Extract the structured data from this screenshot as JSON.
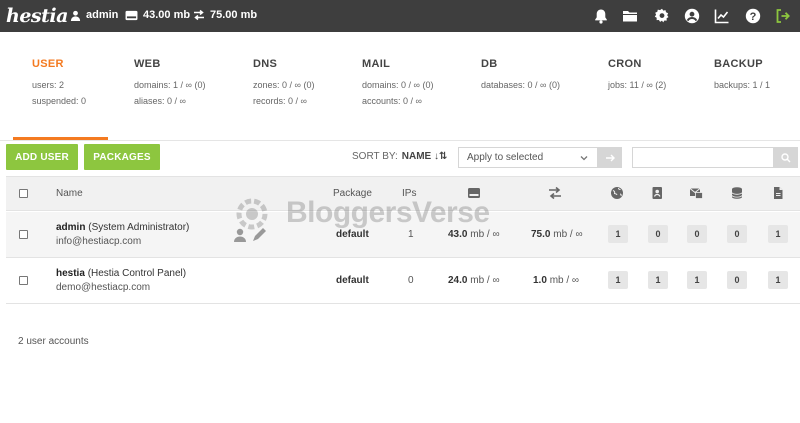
{
  "app": {
    "logo_text": "hestia"
  },
  "topbar": {
    "user": "admin",
    "disk": "43.00 mb",
    "bandwidth": "75.00 mb",
    "icons": [
      "bell-icon",
      "folder-icon",
      "gear-icon",
      "user-circle-icon",
      "chart-line-icon",
      "help-icon",
      "logout-icon"
    ]
  },
  "summary": [
    {
      "title": "USER",
      "lines": [
        "users: 2",
        "suspended: 0"
      ],
      "active": true
    },
    {
      "title": "WEB",
      "lines": [
        "domains: 1 / ∞ (0)",
        "aliases: 0 / ∞"
      ]
    },
    {
      "title": "DNS",
      "lines": [
        "zones: 0 / ∞ (0)",
        "records: 0 / ∞"
      ]
    },
    {
      "title": "MAIL",
      "lines": [
        "domains: 0 / ∞ (0)",
        "accounts: 0 / ∞"
      ]
    },
    {
      "title": "DB",
      "lines": [
        "databases: 0 / ∞ (0)"
      ]
    },
    {
      "title": "CRON",
      "lines": [
        "jobs: 11 / ∞ (2)"
      ]
    },
    {
      "title": "BACKUP",
      "lines": [
        "backups: 1 / 1"
      ]
    }
  ],
  "toolbar": {
    "add_user": "ADD USER",
    "packages": "PACKAGES",
    "sort_by_label": "SORT BY:",
    "sort_by_value": "NAME ↓⇅",
    "bulk_select": "Apply to selected",
    "search_placeholder": ""
  },
  "table": {
    "headers": {
      "name": "Name",
      "package": "Package",
      "ips": "IPs"
    },
    "header_icons": [
      "disk-icon",
      "bandwidth-icon",
      "globe-icon",
      "address-book-icon",
      "mail-icon",
      "database-icon",
      "file-icon"
    ],
    "rows": [
      {
        "username": "admin",
        "fullname": "(System Administrator)",
        "email": "info@hestiacp.com",
        "package": "default",
        "ips": "1",
        "disk_value": "43.0",
        "disk_unit": "mb / ∞",
        "bw_value": "75.0",
        "bw_unit": "mb / ∞",
        "web": "1",
        "dns": "0",
        "mail": "0",
        "db": "0",
        "backup": "1"
      },
      {
        "username": "hestia",
        "fullname": "(Hestia Control Panel)",
        "email": "demo@hestiacp.com",
        "package": "default",
        "ips": "0",
        "disk_value": "24.0",
        "disk_unit": "mb / ∞",
        "bw_value": "1.0",
        "bw_unit": "mb / ∞",
        "web": "1",
        "dns": "1",
        "mail": "1",
        "db": "0",
        "backup": "1"
      }
    ]
  },
  "footer": {
    "count": "2 user accounts"
  },
  "watermark": {
    "text": "BloggersVerse"
  },
  "colors": {
    "accent": "#f47a20",
    "green": "#8dc63f",
    "topbar": "#3e3e3e"
  }
}
